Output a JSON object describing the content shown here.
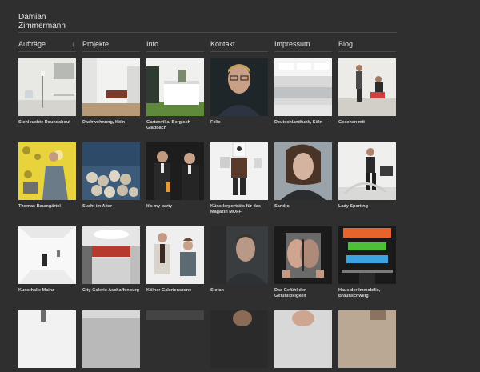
{
  "brand": {
    "line1": "Damian",
    "line2": "Zimmermann"
  },
  "nav": [
    {
      "label": "Aufträge",
      "arrow": "↓"
    },
    {
      "label": "Projekte"
    },
    {
      "label": "Info"
    },
    {
      "label": "Kontakt"
    },
    {
      "label": "Impressum"
    },
    {
      "label": "Blog"
    }
  ],
  "tiles": [
    {
      "caption": "Stehleuchte Roundabout"
    },
    {
      "caption": "Dachwohnung, Köln"
    },
    {
      "caption": "Gartenvilla, Bergisch Gladbach"
    },
    {
      "caption": "Felix"
    },
    {
      "caption": "Deutschlandfunk, Köln"
    },
    {
      "caption": "Gesehen mit"
    },
    {
      "caption": "Thomas Baumgärtel"
    },
    {
      "caption": "Sucht im Alter"
    },
    {
      "caption": "It's my party"
    },
    {
      "caption": "Künstlerporträts für das Magazin MOFF"
    },
    {
      "caption": "Sandra"
    },
    {
      "caption": "Lady Sporting"
    },
    {
      "caption": "Kunsthalle Mainz"
    },
    {
      "caption": "City-Galerie Aschaffenburg"
    },
    {
      "caption": "Kölner Galerienszene"
    },
    {
      "caption": "Stefan"
    },
    {
      "caption": "Das Gefühl der Gefühllosigkeit"
    },
    {
      "caption": "Haus der Immobilie, Braunschweig"
    },
    {
      "caption": ""
    },
    {
      "caption": ""
    },
    {
      "caption": ""
    },
    {
      "caption": ""
    },
    {
      "caption": ""
    },
    {
      "caption": ""
    }
  ]
}
